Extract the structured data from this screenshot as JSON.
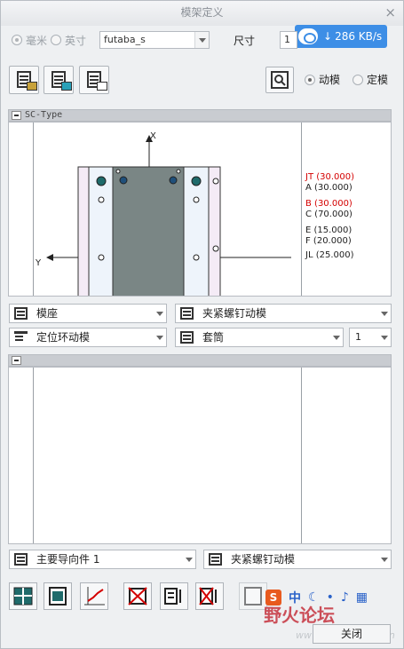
{
  "window": {
    "title": "模架定义",
    "close_label": "×"
  },
  "speed_widget": {
    "speed": "286 KB/s",
    "arrow": "↓"
  },
  "units": {
    "mm_label": "毫米",
    "inch_label": "英寸",
    "selected": "mm"
  },
  "vendor_combo": {
    "value": "futaba_s"
  },
  "size": {
    "label": "尺寸",
    "value": "1"
  },
  "mode": {
    "moving_label": "动模",
    "fixed_label": "定模",
    "selected": "moving"
  },
  "top_panel": {
    "title": "SC-Type",
    "axis_x": "X",
    "axis_y": "Y",
    "legend": [
      {
        "text": "JT (30.000)",
        "highlight": true
      },
      {
        "text": "A (30.000)",
        "highlight": false
      },
      {
        "text": "B (30.000)",
        "highlight": true
      },
      {
        "text": "C (70.000)",
        "highlight": false
      },
      {
        "text": "E (15.000)",
        "highlight": false
      },
      {
        "text": "F (20.000)",
        "highlight": false
      },
      {
        "text": "JL (25.000)",
        "highlight": false
      }
    ]
  },
  "dropdowns": {
    "base": "模座",
    "clamp_screw_1": "夹紧螺钉动模",
    "locating_ring": "定位环动模",
    "sleeve": "套筒",
    "sleeve_count": "1"
  },
  "bottom_panel": {
    "guide": "主要导向件 1",
    "clamp_screw_2": "夹紧螺钉动模"
  },
  "ime": {
    "label": "中"
  },
  "watermark": {
    "text": "野火论坛",
    "url": "www.proewildfire.cn"
  },
  "close_button": "关闭",
  "colors": {
    "plate_fill": "#eef4fb",
    "core_fill": "#7a8685",
    "pin_fill": "#1f6b6b",
    "accent": "#3d8ee6",
    "highlight": "#d40000"
  }
}
